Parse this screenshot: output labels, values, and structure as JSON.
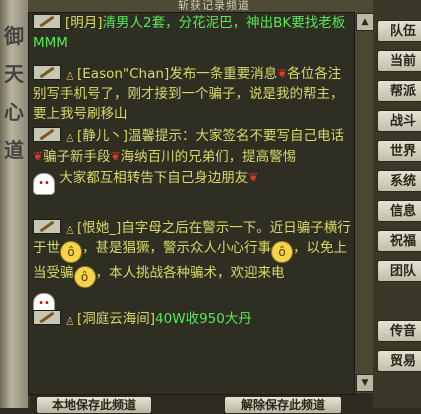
{
  "header": {
    "title": "斩获记录频道"
  },
  "side_decoration": {
    "calligraphy": [
      "御",
      "天",
      "心",
      "道"
    ]
  },
  "messages": [
    {
      "name": "[明月]",
      "text": "清男人2套，分花泥巴，神出BK要找老板MMM"
    },
    {
      "name": "[Eason\"Chan]",
      "text1": "发布一条重要消息",
      "text2": "各位各注别写手机号了，刚才接到一个骗子，说是我的帮主，要上我号刷移山"
    },
    {
      "name": "[静儿丶]",
      "text1": "温馨提示：大家签名不要写自己电话",
      "text2": "骗子新手段",
      "text3": "海纳百川的兄弟们，提高警惕",
      "text4": "大家都互相转告下自己身边朋友"
    },
    {
      "name": "[恨她_]",
      "text1": "自字母之后在警示一下。近日骗子横行于世",
      "text2": "，甚是猖獗，警示众人小心行事",
      "text3": "，以免上当受骗",
      "text4": "，本人挑战各种骗术，欢迎来电"
    },
    {
      "name": "[洞庭云海间]",
      "text": "40W收950大丹"
    }
  ],
  "side_buttons": [
    "队伍",
    "当前",
    "帮派",
    "战斗",
    "世界",
    "系统",
    "信息",
    "祝福",
    "团队",
    "传音",
    "贸易"
  ],
  "bottom_buttons": [
    "本地保存此频道",
    "解除保存此频道"
  ],
  "colors": {
    "name_color": "#d9d96a",
    "text_color": "#58e858",
    "background": "#2f2e22"
  },
  "icons": {
    "rose": "rose-icon",
    "emoji": "smiley-icon",
    "badge": "item-link-icon"
  }
}
